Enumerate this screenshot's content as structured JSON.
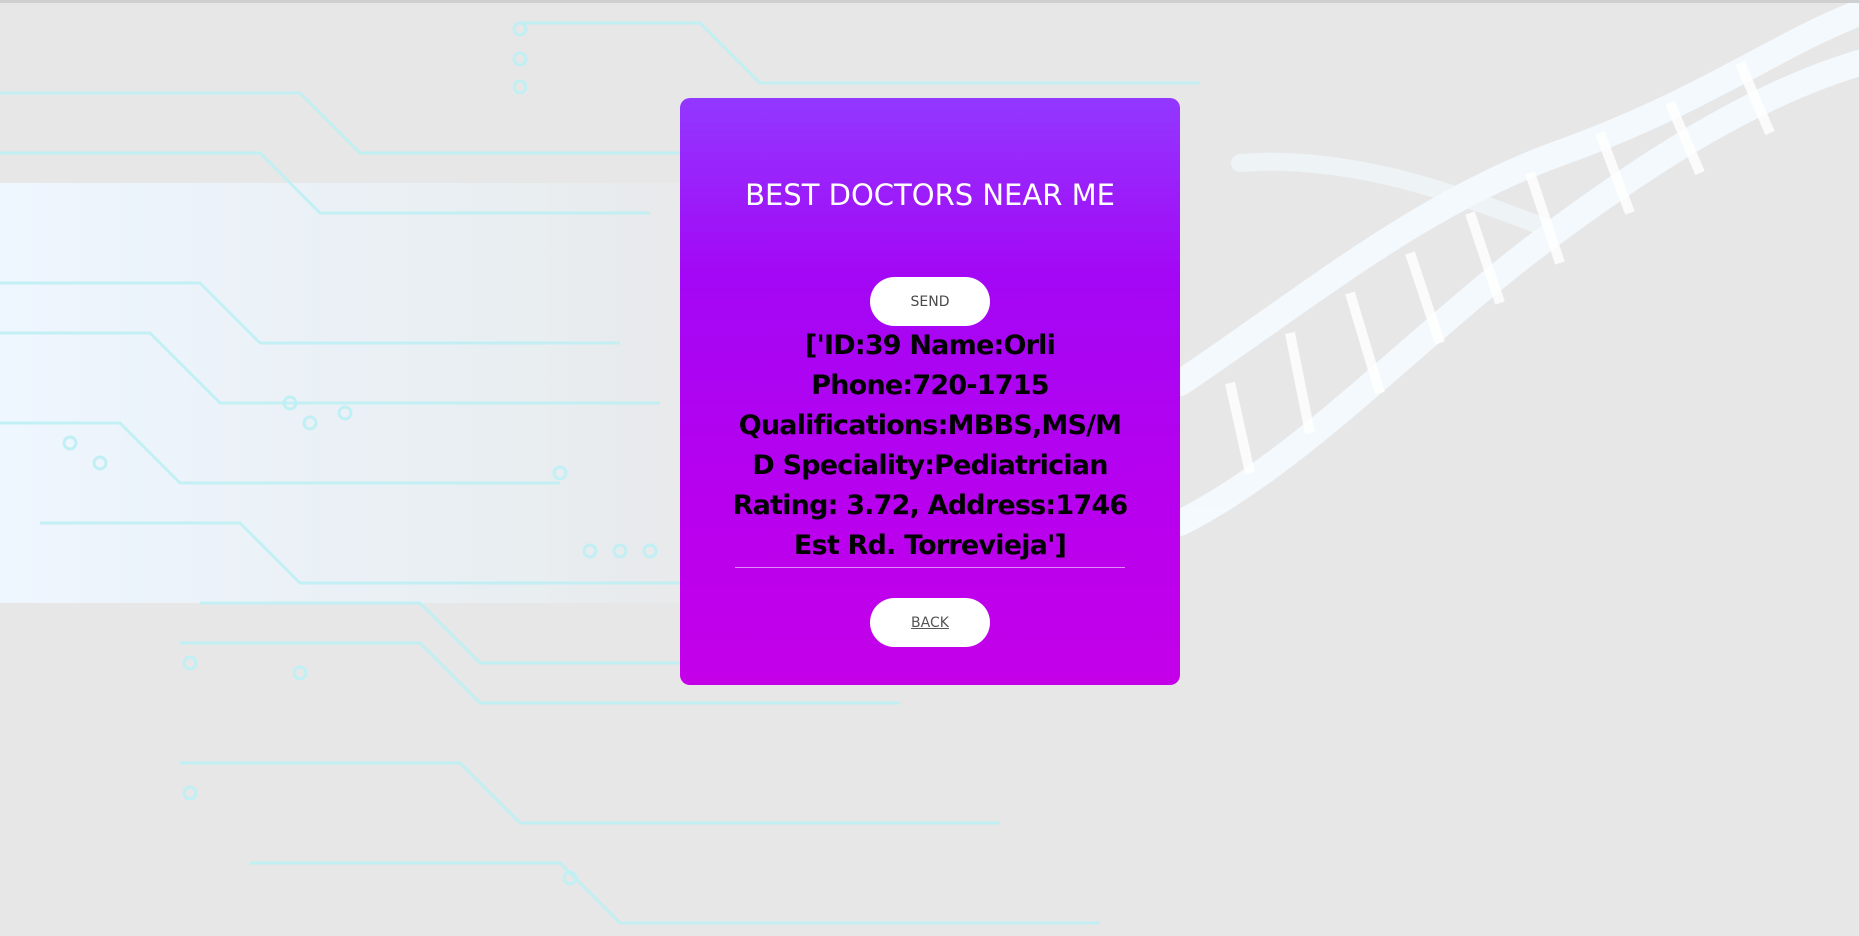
{
  "card": {
    "title": "BEST DOCTORS NEAR ME",
    "send_label": "SEND",
    "result_text": "['ID:39 Name:Orli Phone:720-1715 Qualifications:MBBS,MS/MD Speciality:Pediatrician Rating: 3.72, Address:1746 Est Rd. Torrevieja']",
    "back_label": "BACK"
  },
  "colors": {
    "page_background": "#e8e8e9",
    "card_gradient_top": "#9238ff",
    "card_gradient_bottom": "#c400e9",
    "button_background": "#ffffff"
  },
  "background": {
    "description_icons": [
      "circuit-board-pattern",
      "dna-helix-graphic"
    ]
  }
}
